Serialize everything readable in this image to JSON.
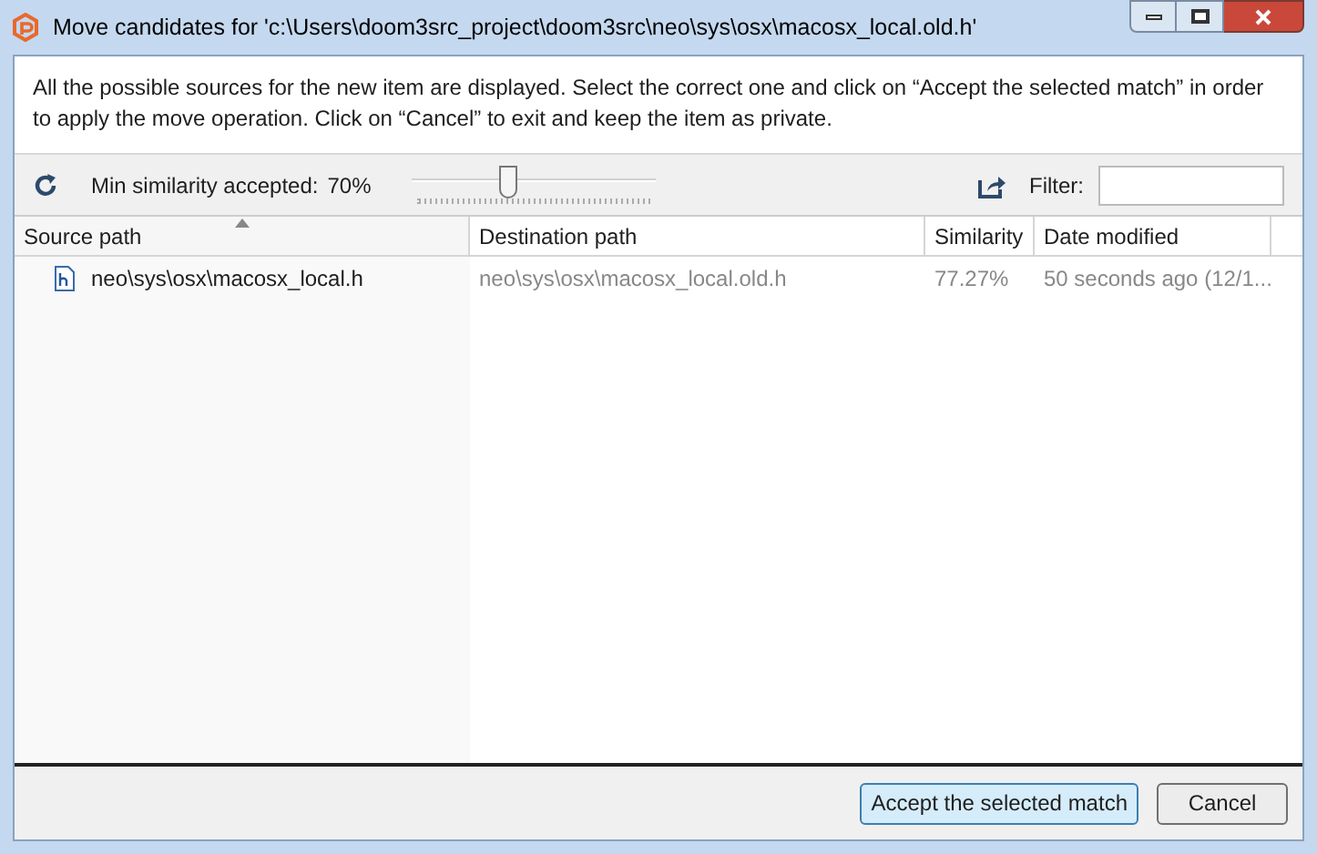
{
  "window": {
    "title": "Move candidates for 'c:\\Users\\doom3src_project\\doom3src\\neo\\sys\\osx\\macosx_local.old.h'"
  },
  "description": "All the possible sources for the new item are displayed. Select the correct one and click on “Accept the selected match” in order to apply the move operation. Click on “Cancel” to exit and keep the item as private.",
  "toolbar": {
    "similarity_label": "Min similarity accepted:",
    "similarity_value": "70%",
    "slider": {
      "level": 0.4
    },
    "filter_label": "Filter:"
  },
  "table": {
    "columns": [
      {
        "label": "Source path",
        "sorted": true
      },
      {
        "label": "Destination path",
        "sorted": false
      },
      {
        "label": "Similarity",
        "sorted": false
      },
      {
        "label": "Date modified",
        "sorted": false
      }
    ],
    "rows": [
      {
        "source": "neo\\sys\\osx\\macosx_local.h",
        "destination": "neo\\sys\\osx\\macosx_local.old.h",
        "similarity": "77.27%",
        "date": "50 seconds ago (12/1..."
      }
    ]
  },
  "buttons": [
    {
      "label": "Accept the selected match",
      "default": true
    },
    {
      "label": "Cancel",
      "default": false
    }
  ]
}
